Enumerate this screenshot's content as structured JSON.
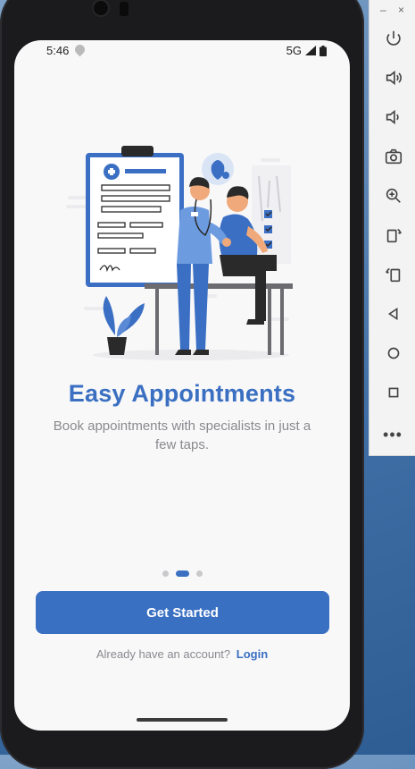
{
  "status_bar": {
    "time": "5:46",
    "network": "5G"
  },
  "onboarding": {
    "title": "Easy Appointments",
    "subtitle": "Book appointments with specialists in just a few taps.",
    "page_count": 3,
    "active_page": 2,
    "cta_label": "Get Started",
    "signin_prompt": "Already have an account?",
    "signin_link": "Login"
  },
  "emulator_panel": {
    "tools": [
      "power-icon",
      "volume-up-icon",
      "volume-down-icon",
      "camera-icon",
      "zoom-icon",
      "rotate-left-icon",
      "rotate-right-icon",
      "back-icon",
      "home-icon",
      "overview-icon"
    ],
    "more_label": "•••"
  },
  "colors": {
    "accent": "#3a6fc1",
    "background": "#f8f8f9",
    "muted_text": "#8a8a8f"
  }
}
